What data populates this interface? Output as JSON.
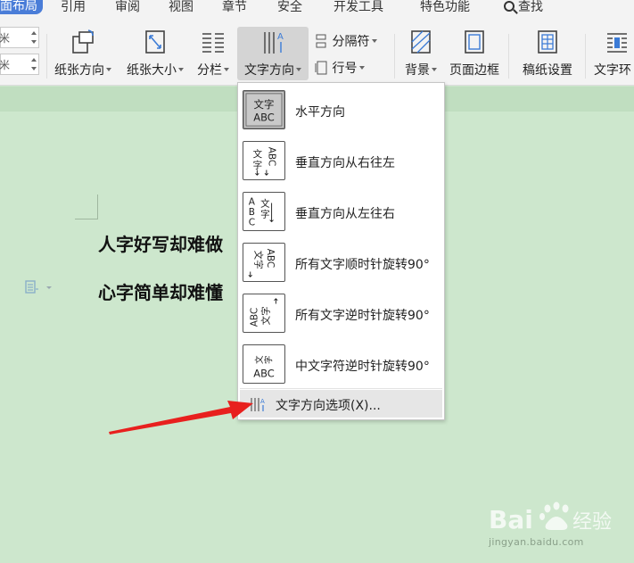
{
  "tabs": [
    {
      "label": "页面布局",
      "visible_text": "面布局",
      "active": true
    },
    {
      "label": "引用"
    },
    {
      "label": "审阅"
    },
    {
      "label": "视图"
    },
    {
      "label": "章节"
    },
    {
      "label": "安全"
    },
    {
      "label": "开发工具"
    },
    {
      "label": "特色功能"
    },
    {
      "label": "查找",
      "icon": "search-icon"
    }
  ],
  "ribbon": {
    "spinner_top": "米",
    "spinner_bottom": "米",
    "orientation_label": "纸张方向",
    "size_label": "纸张大小",
    "columns_label": "分栏",
    "text_direction_label": "文字方向",
    "separator_label": "分隔符",
    "line_number_label": "行号",
    "background_label": "背景",
    "page_border_label": "页面边框",
    "manuscript_label": "稿纸设置",
    "wrap_label": "文字环"
  },
  "document": {
    "line1": "人字好写却难做",
    "line2": "心字简单却难懂"
  },
  "text_direction_menu": {
    "items": [
      {
        "label": "水平方向",
        "icon": "horizontal-text-icon",
        "selected": true
      },
      {
        "label": "垂直方向从右往左",
        "icon": "vertical-rtl-text-icon",
        "selected": false
      },
      {
        "label": "垂直方向从左往右",
        "icon": "vertical-ltr-text-icon",
        "selected": false
      },
      {
        "label": "所有文字顺时针旋转90°",
        "icon": "rotate-cw-text-icon",
        "selected": false
      },
      {
        "label": "所有文字逆时针旋转90°",
        "icon": "rotate-ccw-text-icon",
        "selected": false
      },
      {
        "label": "中文字符逆时针旋转90°",
        "icon": "cjk-rotate-ccw-text-icon",
        "selected": false
      }
    ],
    "options_label": "文字方向选项(X)...",
    "icon_text_cn": "文字",
    "icon_text_en": "ABC"
  },
  "watermark": {
    "brand": "Baidu经验",
    "url": "jingyan.baidu.com"
  },
  "colors": {
    "accent": "#4a7dd8",
    "doc_background": "#cde7cd",
    "ribbon_background": "#f3f3f3",
    "annotation_arrow": "#e8201e"
  }
}
